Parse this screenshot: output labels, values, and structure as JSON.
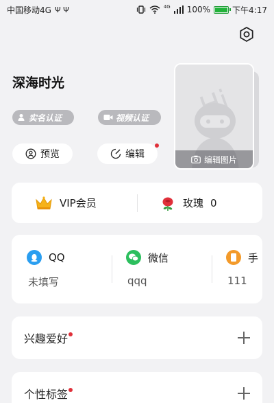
{
  "status_bar": {
    "carrier": "中国移动4G",
    "usb_icons": "Ψ Ψ",
    "signal_label": "4G",
    "battery": "100%",
    "time": "下午4:17"
  },
  "profile": {
    "nickname": "深海时光",
    "badges": {
      "real_name": "实名认证",
      "video": "视频认证"
    },
    "buttons": {
      "preview": "预览",
      "edit": "编辑"
    },
    "photo": {
      "edit_label": "编辑图片"
    }
  },
  "vip": {
    "label": "VIP会员",
    "rose_label": "玫瑰",
    "rose_count": "0"
  },
  "social": [
    {
      "name": "QQ",
      "value": "未填写",
      "icon": "qq-icon",
      "color": "#2a9ef0"
    },
    {
      "name": "微信",
      "value": "qqq",
      "icon": "wechat-icon",
      "color": "#2cbf5e"
    },
    {
      "name": "手",
      "value": "111",
      "icon": "phone-icon",
      "color": "#f39a2a"
    }
  ],
  "sections": {
    "interests": "兴趣爱好",
    "personal_tags": "个性标签"
  },
  "colors": {
    "accent_red": "#e0303a",
    "badge_gray": "#b9b9bd",
    "background": "#f2f2f4"
  }
}
